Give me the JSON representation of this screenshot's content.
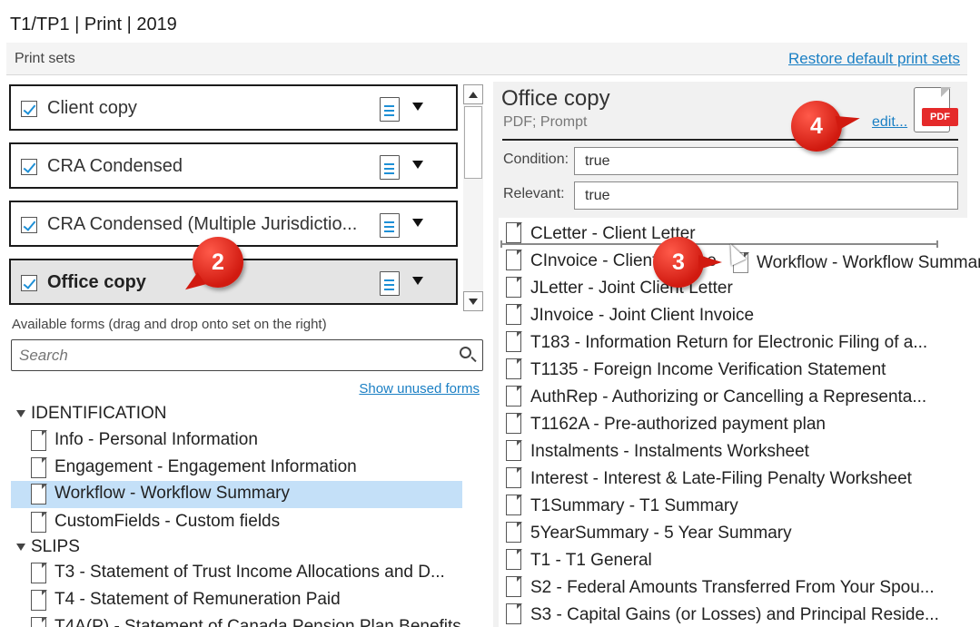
{
  "title": "T1/TP1 | Print | 2019",
  "print_sets": {
    "label": "Print sets",
    "restore_link": "Restore default print sets",
    "sets": [
      {
        "label": "Client copy",
        "checked": true,
        "selected": false
      },
      {
        "label": "CRA Condensed",
        "checked": true,
        "selected": false
      },
      {
        "label": "CRA Condensed (Multiple Jurisdictio...",
        "checked": true,
        "selected": false
      },
      {
        "label": "Office copy",
        "checked": true,
        "selected": true
      }
    ]
  },
  "available": {
    "label": "Available forms (drag and drop onto set on the right)",
    "search_placeholder": "Search",
    "show_unused": "Show unused forms",
    "groups": [
      {
        "label": "IDENTIFICATION"
      },
      {
        "label": "SLIPS"
      }
    ],
    "identification_items": [
      "Info - Personal Information",
      "Engagement - Engagement Information",
      "Workflow - Workflow Summary",
      "CustomFields - Custom fields"
    ],
    "slips_items": [
      "T3 - Statement of Trust Income Allocations and D...",
      "T4 - Statement of Remuneration Paid",
      "T4A(P) - Statement of Canada Pension Plan Benefits"
    ]
  },
  "office_copy": {
    "title": "Office copy",
    "subtitle": "PDF; Prompt",
    "edit_link": "edit...",
    "pdf_badge": "PDF",
    "condition_label": "Condition:",
    "condition_value": "true",
    "relevant_label": "Relevant:",
    "relevant_value": "true",
    "forms": [
      "CLetter - Client Letter",
      "CInvoice - Client Invoice",
      "JLetter - Joint Client Letter",
      "JInvoice - Joint Client Invoice",
      "T183 - Information Return for Electronic Filing of a...",
      "T1135 - Foreign Income Verification Statement",
      "AuthRep - Authorizing or Cancelling a Representa...",
      "T1162A - Pre-authorized payment plan",
      "Instalments - Instalments Worksheet",
      "Interest - Interest & Late-Filing Penalty Worksheet",
      "T1Summary - T1 Summary",
      "5YearSummary - 5 Year Summary",
      "T1 - T1 General",
      "S2 - Federal Amounts Transferred From Your Spou...",
      "S3 - Capital Gains (or Losses) and Principal Reside..."
    ]
  },
  "drag_ghost": "Workflow - Workflow Summary",
  "callouts": [
    "2",
    "3",
    "4"
  ],
  "colors": {
    "link": "#1a7fc4",
    "highlight": "#c4e0f8",
    "callout": "#d11a10",
    "check": "#1d8fd6"
  }
}
